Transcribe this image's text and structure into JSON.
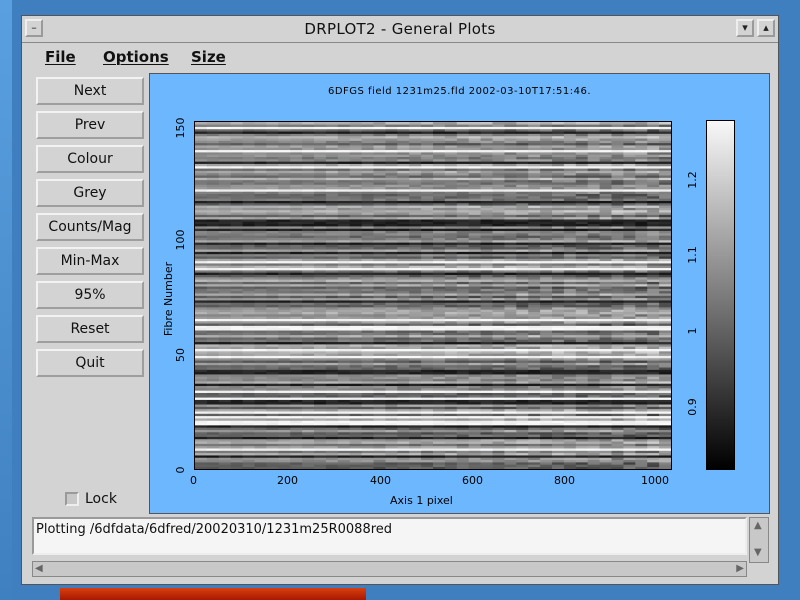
{
  "window": {
    "title": "DRPLOT2 - General Plots"
  },
  "menu": {
    "items": [
      "File",
      "Options",
      "Size"
    ]
  },
  "buttons": [
    "Next",
    "Prev",
    "Colour",
    "Grey",
    "Counts/Mag",
    "Min-Max",
    "95%",
    "Reset",
    "Quit"
  ],
  "lock": {
    "label": "Lock",
    "checked": false
  },
  "plot": {
    "title": "6DFGS field 1231m25.fld 2002-03-10T17:51:46.",
    "xlabel": "Axis 1 pixel",
    "ylabel": "Fibre Number",
    "xticks": [
      "0",
      "200",
      "400",
      "600",
      "800",
      "1000"
    ],
    "yticks": [
      "0",
      "50",
      "100",
      "150"
    ],
    "colorbar_ticks": [
      "0.9",
      "1",
      "1.1",
      "1.2"
    ]
  },
  "chart_data": {
    "type": "heatmap",
    "title": "6DFGS field 1231m25.fld 2002-03-10T17:51:46.",
    "xlabel": "Axis 1 pixel",
    "ylabel": "Fibre Number",
    "xlim": [
      0,
      1030
    ],
    "ylim": [
      0,
      150
    ],
    "xticks": [
      0,
      200,
      400,
      600,
      800,
      1000
    ],
    "yticks": [
      0,
      50,
      100,
      150
    ],
    "colorbar": {
      "range": [
        0.85,
        1.28
      ],
      "ticks": [
        0.9,
        1,
        1.1,
        1.2
      ],
      "colormap": "grey"
    }
  },
  "status": {
    "text": "Plotting /6dfdata/6dfred/20020310/1231m25R0088red"
  },
  "colors": {
    "plot_background": "#6db7ff",
    "window": "#d3d3d3",
    "desktop": "#3f7fc0"
  }
}
